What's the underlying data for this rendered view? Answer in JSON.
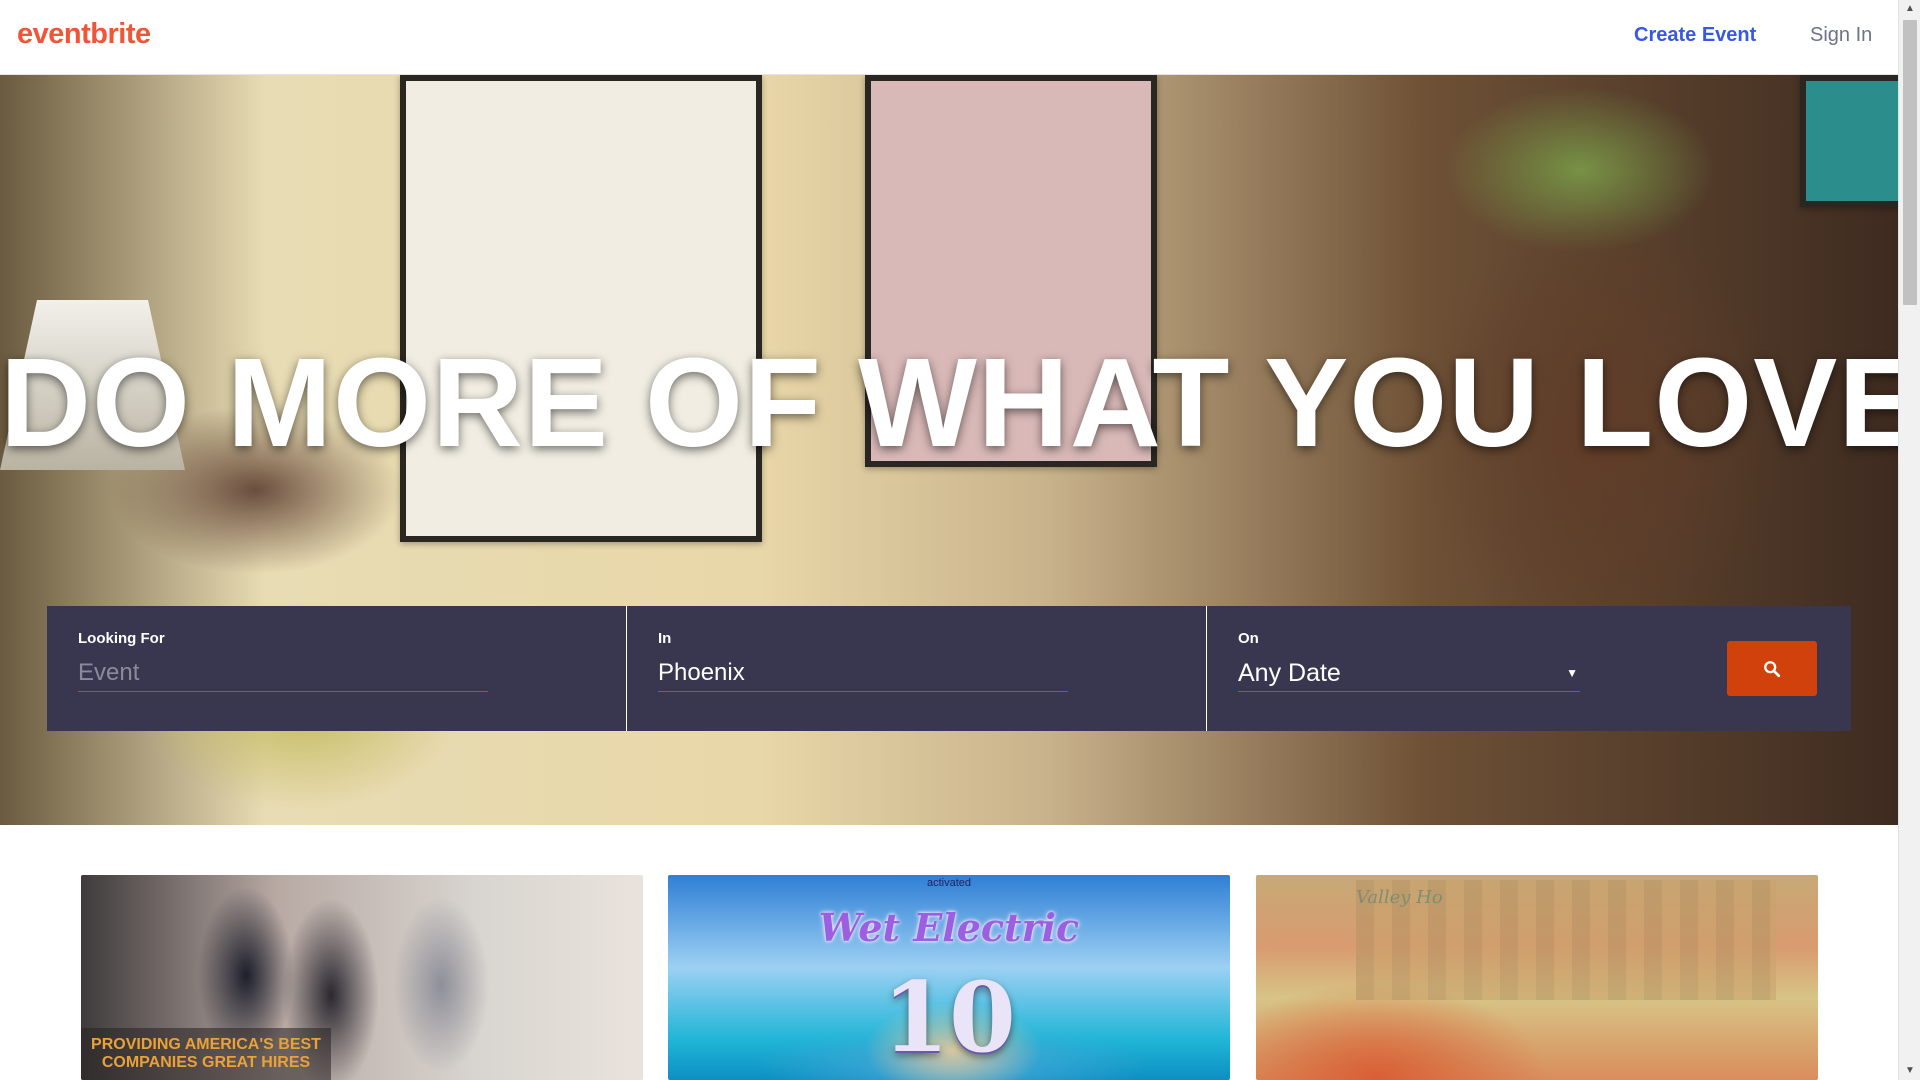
{
  "header": {
    "logo": "eventbrite",
    "create_event": "Create Event",
    "sign_in": "Sign In"
  },
  "hero": {
    "title": "DO MORE OF WHAT YOU LOVE"
  },
  "search": {
    "looking_for_label": "Looking For",
    "looking_for_placeholder": "Event",
    "looking_for_value": "",
    "in_label": "In",
    "in_value": "Phoenix",
    "on_label": "On",
    "on_value": "Any Date",
    "search_icon": "search-icon"
  },
  "cards": [
    {
      "caption": "PROVIDING AMERICA'S BEST COMPANIES GREAT HIRES"
    },
    {
      "brand": "activated",
      "title": "Wet Electric",
      "number": "10"
    },
    {
      "sign": "Valley Ho"
    }
  ],
  "colors": {
    "brand_orange": "#f05537",
    "link_blue": "#3659e3",
    "search_bar_bg": "#39364f",
    "search_button": "#d1410c"
  }
}
